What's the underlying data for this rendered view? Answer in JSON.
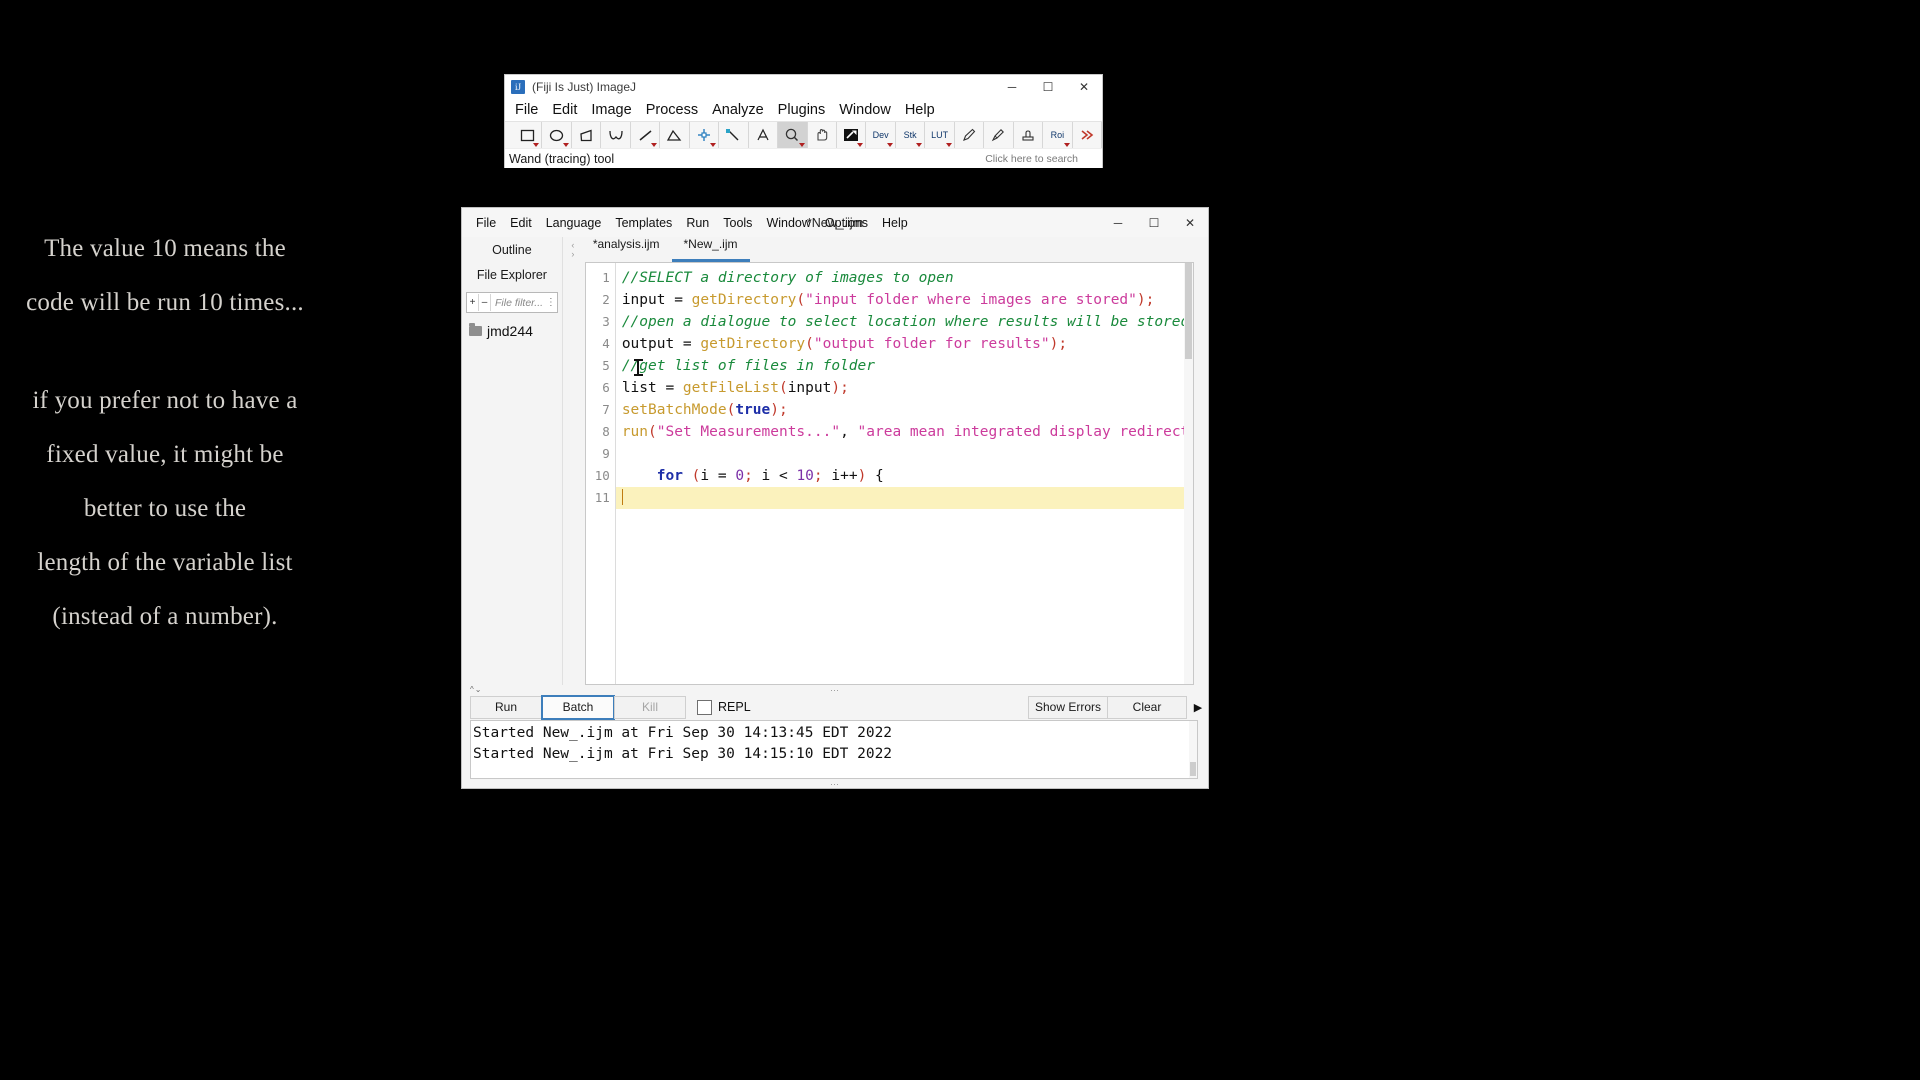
{
  "caption": {
    "paragraph1": "The value 10 means the code will be run 10 times...",
    "paragraph2": "if you prefer not to have a fixed value, it might be better to use the",
    "paragraph3": "length of the variable list (instead of a number)."
  },
  "fiji_window": {
    "title": "(Fiji Is Just) ImageJ",
    "icon": "fiji-logo-icon",
    "window_buttons": [
      {
        "name": "minimize",
        "glyph": "─"
      },
      {
        "name": "maximize",
        "glyph": "☐"
      },
      {
        "name": "close",
        "glyph": "✕"
      }
    ],
    "menus": [
      "File",
      "Edit",
      "Image",
      "Process",
      "Analyze",
      "Plugins",
      "Window",
      "Help"
    ],
    "tools": [
      {
        "name": "rectangle-tool",
        "icon": "rectangle-icon",
        "dropdown": true,
        "selected": false
      },
      {
        "name": "oval-tool",
        "icon": "oval-icon",
        "dropdown": true,
        "selected": false
      },
      {
        "name": "polygon-tool",
        "icon": "polygon-icon",
        "dropdown": false,
        "selected": false
      },
      {
        "name": "freehand-tool",
        "icon": "freehand-icon",
        "dropdown": false,
        "selected": false
      },
      {
        "name": "line-tool",
        "icon": "line-icon",
        "dropdown": true,
        "selected": false
      },
      {
        "name": "angle-tool",
        "icon": "angle-icon",
        "dropdown": false,
        "selected": false
      },
      {
        "name": "point-tool",
        "icon": "point-icon",
        "dropdown": true,
        "selected": false
      },
      {
        "name": "wand-tool",
        "icon": "wand-icon",
        "dropdown": false,
        "selected": false
      },
      {
        "name": "text-tool",
        "icon": "text-a-icon",
        "dropdown": false,
        "selected": false
      },
      {
        "name": "magnifier-tool",
        "icon": "magnifier-icon",
        "dropdown": true,
        "selected": true
      },
      {
        "name": "hand-tool",
        "icon": "hand-icon",
        "dropdown": false,
        "selected": false
      },
      {
        "name": "dropper-tool",
        "icon": "color-picker-icon",
        "dropdown": true,
        "selected": false
      },
      {
        "name": "dev-tool",
        "label": "Dev",
        "dropdown": true,
        "selected": false
      },
      {
        "name": "stk-tool",
        "label": "Stk",
        "dropdown": true,
        "selected": false
      },
      {
        "name": "lut-tool",
        "label": "LUT",
        "dropdown": true,
        "selected": false
      },
      {
        "name": "pencil-tool",
        "icon": "pencil-icon",
        "dropdown": false,
        "selected": false
      },
      {
        "name": "brush-tool",
        "icon": "brush-icon",
        "dropdown": false,
        "selected": false
      },
      {
        "name": "eraser-tool",
        "icon": "stamp-icon",
        "dropdown": false,
        "selected": false
      },
      {
        "name": "roi-tool",
        "label": "Roi",
        "dropdown": true,
        "selected": false
      },
      {
        "name": "more-tools",
        "icon": "double-chevron-icon",
        "dropdown": false,
        "selected": false
      }
    ],
    "status_text": "Wand (tracing) tool",
    "search_hint": "Click here to search"
  },
  "editor_window": {
    "document_title": "*New_.ijm",
    "menus": [
      "File",
      "Edit",
      "Language",
      "Templates",
      "Run",
      "Tools",
      "Window",
      "Options",
      "Help"
    ],
    "window_buttons": [
      {
        "name": "minimize",
        "glyph": "─"
      },
      {
        "name": "maximize",
        "glyph": "☐"
      },
      {
        "name": "close",
        "glyph": "✕"
      }
    ],
    "left_panel": {
      "outline_tab": "Outline",
      "file_explorer_tab": "File Explorer",
      "filter_placeholder": "File filter...",
      "expand_button": "+",
      "collapse_button": "–",
      "options_button": "⋮",
      "tree_items": [
        {
          "label": "jmd244",
          "icon": "folder-icon"
        }
      ]
    },
    "tabs": [
      {
        "label": "*analysis.ijm",
        "active": false
      },
      {
        "label": "*New_.ijm",
        "active": true
      }
    ],
    "tab_arrows": {
      "prev": "‹",
      "next": "›"
    },
    "code_lines": [
      {
        "num": "1",
        "current": false,
        "tokens": [
          {
            "t": "//SELECT a directory of images to open",
            "c": "c-com"
          }
        ]
      },
      {
        "num": "2",
        "current": false,
        "tokens": [
          {
            "t": "input = ",
            "c": "c-plain"
          },
          {
            "t": "getDirectory",
            "c": "c-fn"
          },
          {
            "t": "(",
            "c": "c-par"
          },
          {
            "t": "\"input folder where images are stored\"",
            "c": "c-str"
          },
          {
            "t": ")",
            "c": "c-par"
          },
          {
            "t": ";",
            "c": "c-par"
          }
        ]
      },
      {
        "num": "3",
        "current": false,
        "tokens": [
          {
            "t": "//open a dialogue to select location where results will be stored",
            "c": "c-com"
          }
        ]
      },
      {
        "num": "4",
        "current": false,
        "tokens": [
          {
            "t": "output = ",
            "c": "c-plain"
          },
          {
            "t": "getDirectory",
            "c": "c-fn"
          },
          {
            "t": "(",
            "c": "c-par"
          },
          {
            "t": "\"output folder for results\"",
            "c": "c-str"
          },
          {
            "t": ")",
            "c": "c-par"
          },
          {
            "t": ";",
            "c": "c-par"
          }
        ]
      },
      {
        "num": "5",
        "current": false,
        "tokens": [
          {
            "t": "//get list of files in folder",
            "c": "c-com"
          }
        ]
      },
      {
        "num": "6",
        "current": false,
        "tokens": [
          {
            "t": "list = ",
            "c": "c-plain"
          },
          {
            "t": "getFileList",
            "c": "c-fn"
          },
          {
            "t": "(",
            "c": "c-par"
          },
          {
            "t": "input",
            "c": "c-plain"
          },
          {
            "t": ")",
            "c": "c-par"
          },
          {
            "t": ";",
            "c": "c-par"
          }
        ]
      },
      {
        "num": "7",
        "current": false,
        "tokens": [
          {
            "t": "setBatchMode",
            "c": "c-fn"
          },
          {
            "t": "(",
            "c": "c-par"
          },
          {
            "t": "true",
            "c": "c-kw"
          },
          {
            "t": ")",
            "c": "c-par"
          },
          {
            "t": ";",
            "c": "c-par"
          }
        ]
      },
      {
        "num": "8",
        "current": false,
        "tokens": [
          {
            "t": "run",
            "c": "c-fn"
          },
          {
            "t": "(",
            "c": "c-par"
          },
          {
            "t": "\"Set Measurements...\"",
            "c": "c-str"
          },
          {
            "t": ", ",
            "c": "c-plain"
          },
          {
            "t": "\"area mean integrated display redirect=None",
            "c": "c-str"
          }
        ]
      },
      {
        "num": "9",
        "current": false,
        "tokens": []
      },
      {
        "num": "10",
        "current": false,
        "tokens": [
          {
            "t": "    ",
            "c": "c-plain"
          },
          {
            "t": "for",
            "c": "c-kw"
          },
          {
            "t": " ",
            "c": "c-plain"
          },
          {
            "t": "(",
            "c": "c-par"
          },
          {
            "t": "i = ",
            "c": "c-plain"
          },
          {
            "t": "0",
            "c": "c-num"
          },
          {
            "t": ";",
            "c": "c-par"
          },
          {
            "t": " i < ",
            "c": "c-plain"
          },
          {
            "t": "10",
            "c": "c-num"
          },
          {
            "t": ";",
            "c": "c-par"
          },
          {
            "t": " i++",
            "c": "c-plain"
          },
          {
            "t": ")",
            "c": "c-par"
          },
          {
            "t": " {",
            "c": "c-plain"
          }
        ]
      },
      {
        "num": "11",
        "current": true,
        "tokens": []
      }
    ],
    "run_bar": {
      "run_label": "Run",
      "batch_label": "Batch",
      "kill_label": "Kill",
      "repl_label": "REPL",
      "repl_checked": false,
      "show_errors_label": "Show Errors",
      "clear_label": "Clear",
      "play_arrow": "▶"
    },
    "console_lines": [
      "Started New_.ijm at Fri Sep 30 14:13:45 EDT 2022",
      "Started New_.ijm at Fri Sep 30 14:15:10 EDT 2022"
    ]
  },
  "colors": {
    "accent": "#3d7ebb",
    "current_line_highlight": "#fbf2bd",
    "comment_green": "#1a8a3c",
    "string_pink": "#cc3b9c",
    "function_gold": "#c79a2e",
    "keyword_blue": "#1e2fa8",
    "number_purple": "#7b30a8",
    "paren_red": "#c0392b"
  }
}
